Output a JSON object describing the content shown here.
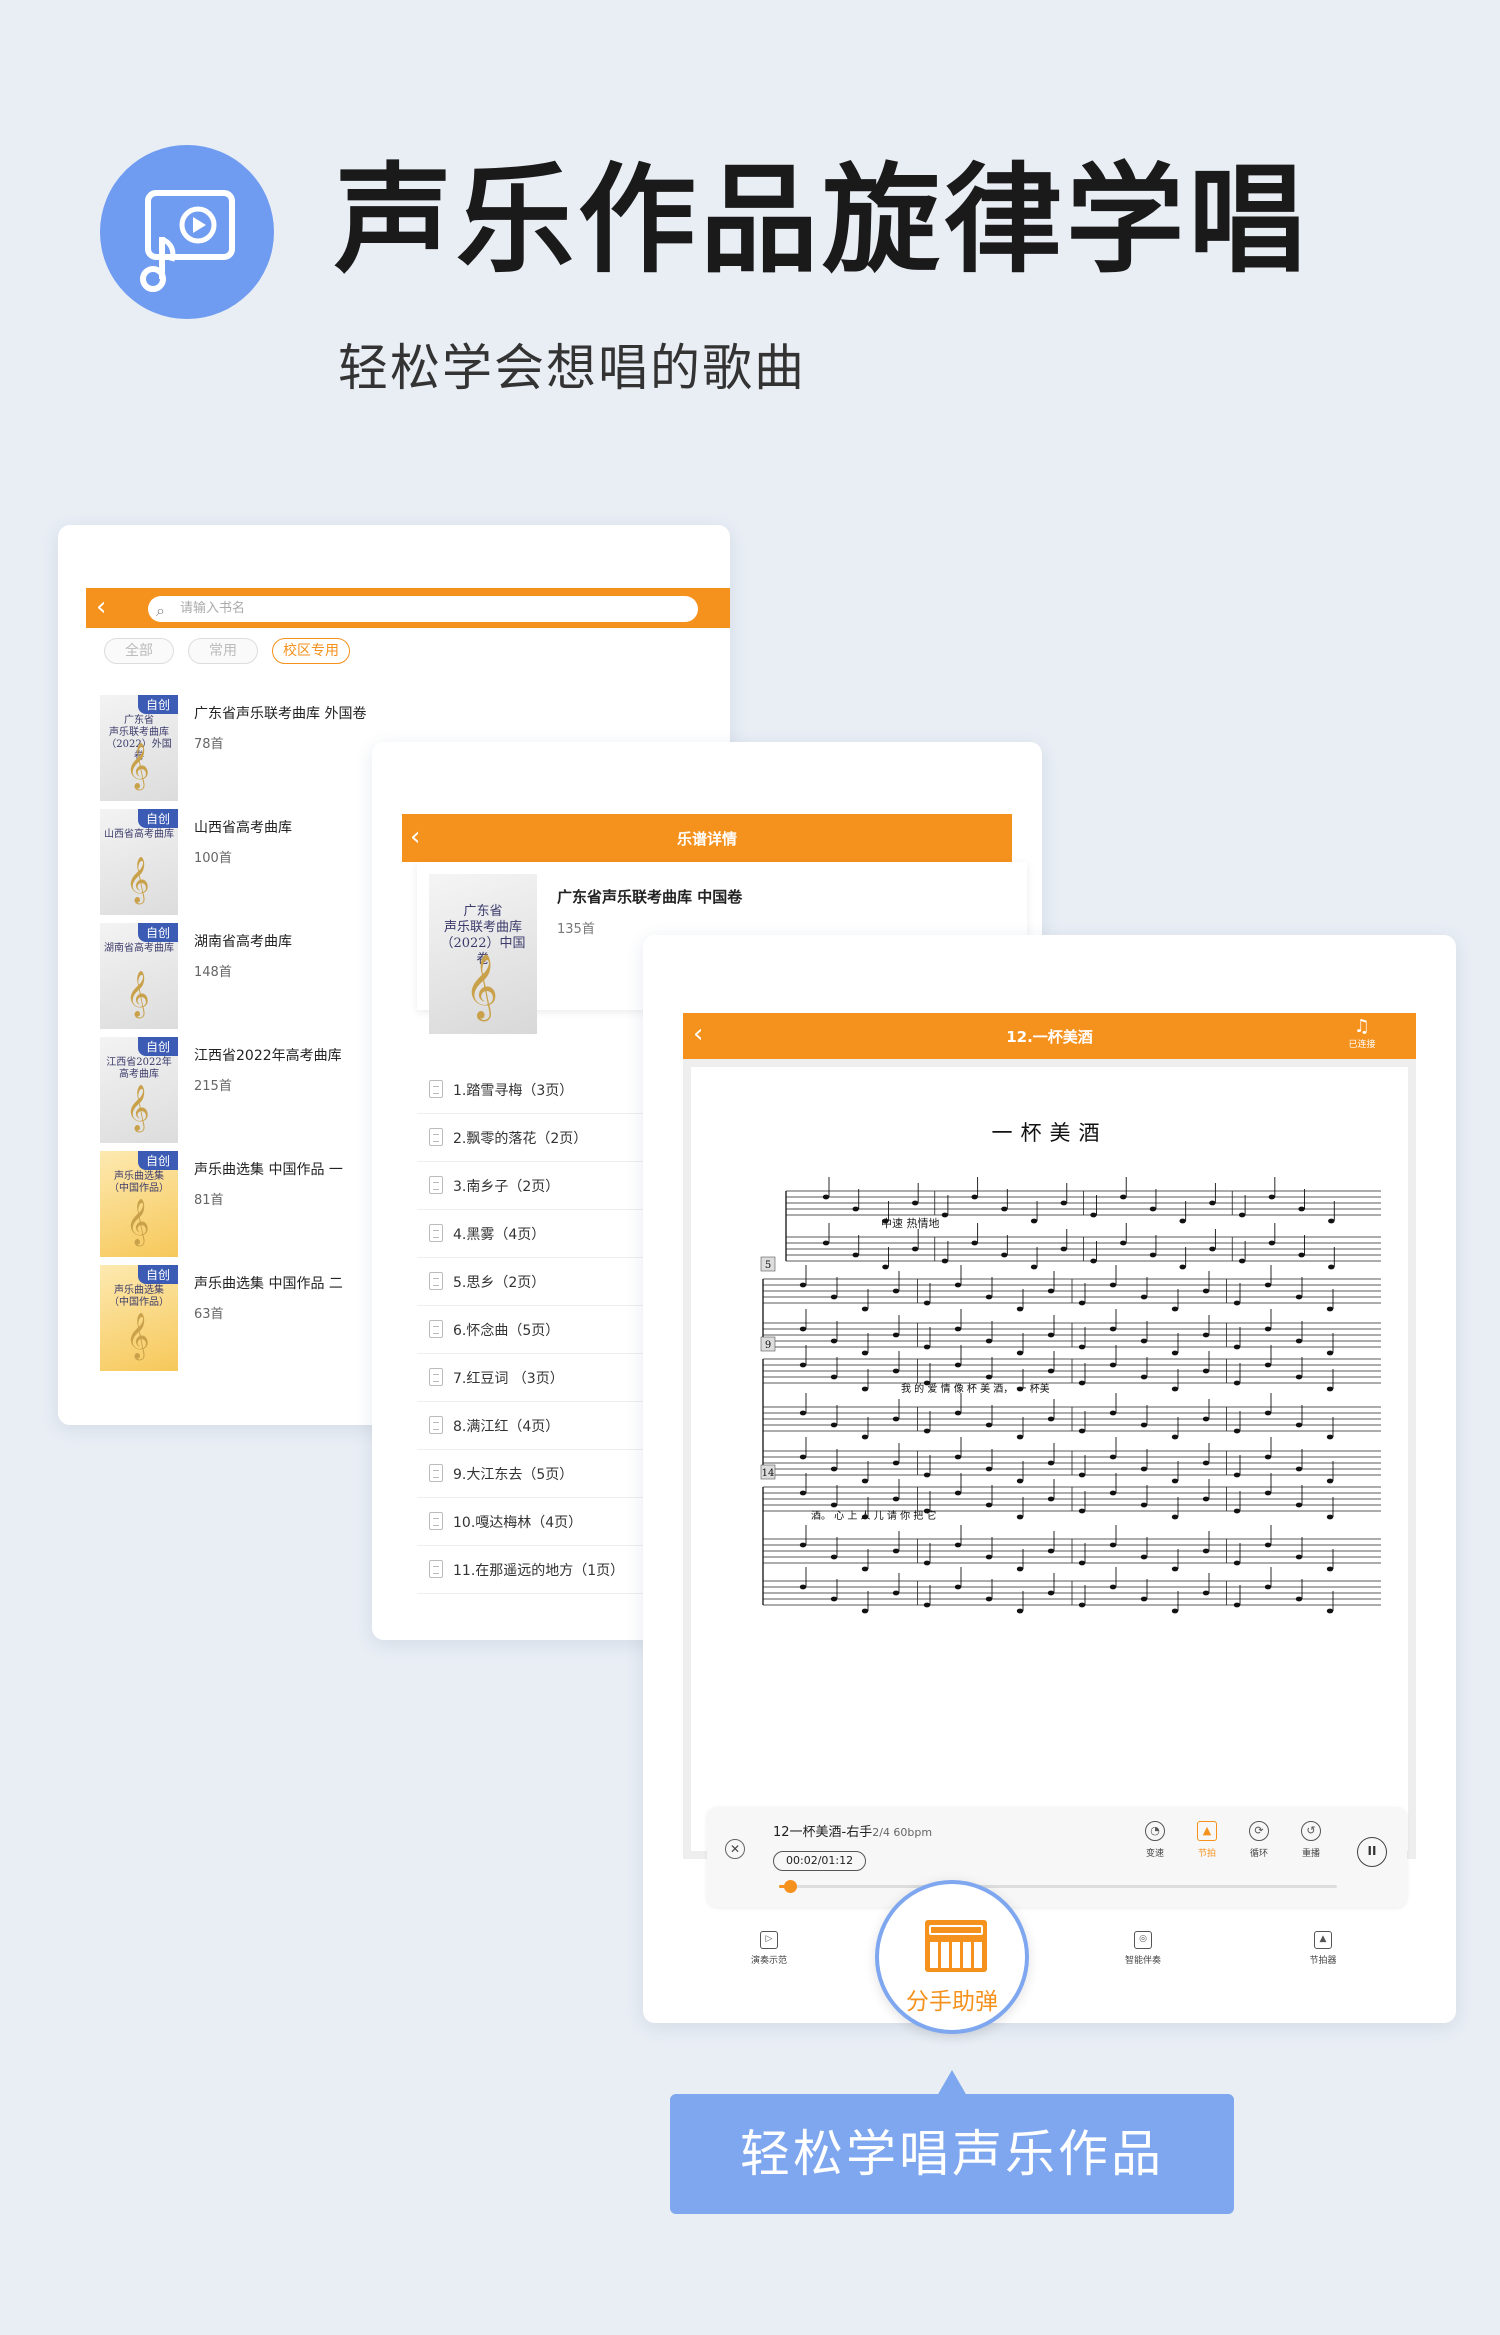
{
  "hero": {
    "title": "声乐作品旋律学唱",
    "subtitle": "轻松学会想唱的歌曲",
    "icon": "video-music-icon",
    "accent": "#6f9cf0"
  },
  "library": {
    "search_placeholder": "请输入书名",
    "tabs": [
      {
        "label": "全部",
        "active": false
      },
      {
        "label": "常用",
        "active": false
      },
      {
        "label": "校区专用",
        "active": true
      }
    ],
    "books": [
      {
        "badge": "自创",
        "cover_title": "广东省\n声乐联考曲库\n（2022）外国卷",
        "name": "广东省声乐联考曲库 外国卷",
        "count": "78首",
        "cover": "white"
      },
      {
        "badge": "自创",
        "cover_title": "山西省高考曲库",
        "name": "山西省高考曲库",
        "count": "100首",
        "cover": "white"
      },
      {
        "badge": "自创",
        "cover_title": "湖南省高考曲库",
        "name": "湖南省高考曲库",
        "count": "148首",
        "cover": "white"
      },
      {
        "badge": "自创",
        "cover_title": "江西省2022年\n高考曲库",
        "name": "江西省2022年高考曲库",
        "count": "215首",
        "cover": "white"
      },
      {
        "badge": "自创",
        "cover_title": "声乐曲选集\n（中国作品）",
        "name": "声乐曲选集 中国作品 一",
        "count": "81首",
        "cover": "yellow"
      },
      {
        "badge": "自创",
        "cover_title": "声乐曲选集\n（中国作品）",
        "name": "声乐曲选集 中国作品 二",
        "count": "63首",
        "cover": "yellow"
      }
    ]
  },
  "detail": {
    "title": "乐谱详情",
    "book_cover_title": "广东省\n声乐联考曲库\n（2022）中国卷",
    "book_name": "广东省声乐联考曲库 中国卷",
    "book_count": "135首",
    "songs": [
      "1.踏雪寻梅（3页）",
      "2.飘零的落花（2页）",
      "3.南乡子（2页）",
      "4.黑雾（4页）",
      "5.思乡（2页）",
      "6.怀念曲（5页）",
      "7.红豆词 （3页）",
      "8.满江红（4页）",
      "9.大江东去（5页）",
      "10.嘎达梅林（4页）",
      "11.在那遥远的地方（1页）"
    ]
  },
  "player": {
    "title": "12.一杯美酒",
    "connected_label": "已连接",
    "sheet_title": "一杯美酒",
    "tempo_mark": "中速 热情地",
    "lyrics_line1": "我 的 爱 情    像 杯 美 酒，  一 杯美",
    "lyrics_line2": "酒。                              心 上 人 儿   请 你 把 它",
    "measure_numbers": [
      "5",
      "9",
      "14"
    ],
    "track_name": "12一杯美酒-右手",
    "track_meta": "2/4 60bpm",
    "time": "00:02/01:12",
    "progress": 0.02,
    "controls": [
      {
        "label": "变速",
        "icon": "speed-icon",
        "glyph": "◔",
        "on": false
      },
      {
        "label": "节拍",
        "icon": "metronome-icon",
        "glyph": "▲",
        "on": true
      },
      {
        "label": "循环",
        "icon": "loop-icon",
        "glyph": "⟳",
        "on": false
      },
      {
        "label": "重播",
        "icon": "replay-icon",
        "glyph": "↺",
        "on": false
      }
    ],
    "pause_glyph": "II",
    "nav": [
      {
        "label": "演奏示范",
        "icon": "play-demo-icon",
        "glyph": "▷"
      },
      {
        "label": "智能伴奏",
        "icon": "accompany-icon",
        "glyph": "◎"
      },
      {
        "label": "节拍器",
        "icon": "metronome-icon",
        "glyph": "▲"
      }
    ],
    "accent": "#f5921e"
  },
  "fab": {
    "label": "分手助弹",
    "icon": "piano-icon"
  },
  "callout": {
    "text": "轻松学唱声乐作品"
  }
}
